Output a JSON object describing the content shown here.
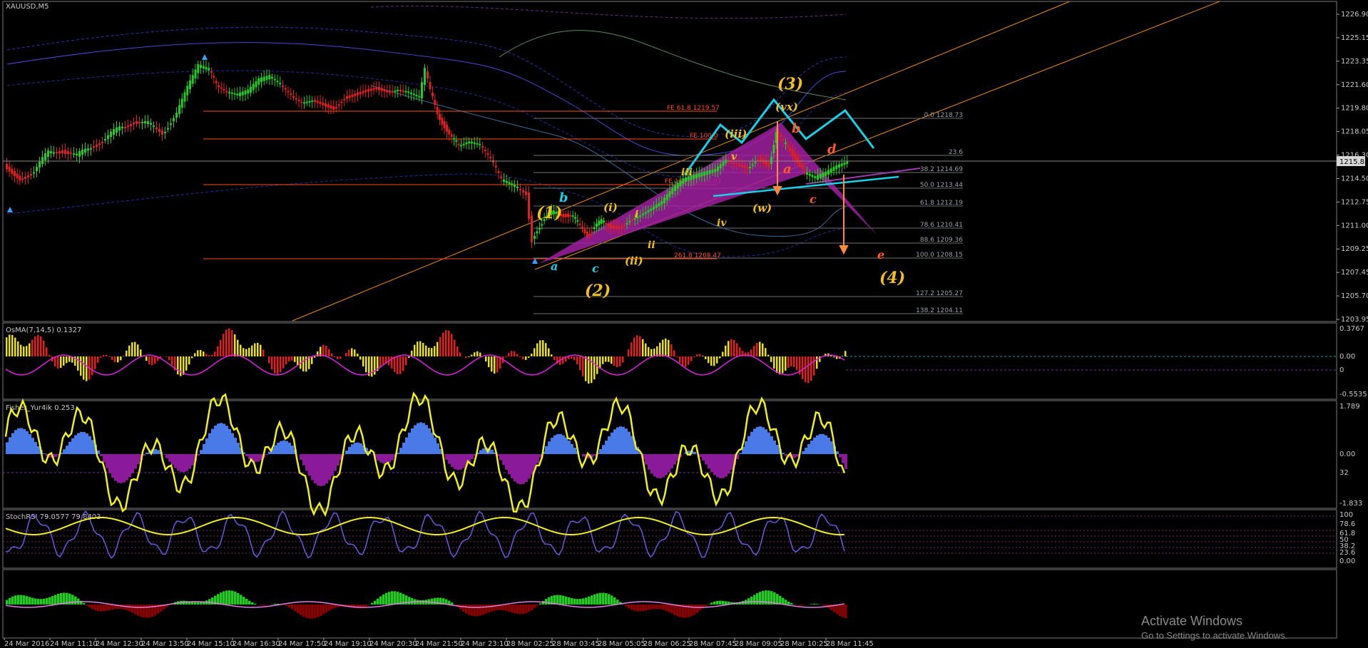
{
  "symbol": "XAUUSD,M5",
  "main_chart": {
    "type": "candlestick",
    "price_ticks": [
      "1226.90",
      "1225.15",
      "1223.35",
      "1221.60",
      "1219.80",
      "1218.05",
      "1216.30",
      "1214.50",
      "1212.75",
      "1211.00",
      "1209.25",
      "1207.45",
      "1205.70",
      "1203.95"
    ],
    "current_price": "1215.85",
    "ylim": [
      1203.95,
      1227.1
    ]
  },
  "time_ticks": [
    "24 Mar 2016",
    "24 Mar 11:10",
    "24 Mar 12:30",
    "24 Mar 13:50",
    "24 Mar 15:10",
    "24 Mar 16:30",
    "24 Mar 17:50",
    "24 Mar 19:10",
    "24 Mar 20:30",
    "24 Mar 21:50",
    "24 Mar 23:10",
    "28 Mar 02:25",
    "28 Mar 03:45",
    "28 Mar 05:05",
    "28 Mar 06:25",
    "28 Mar 07:45",
    "28 Mar 09:05",
    "28 Mar 10:25",
    "28 Mar 11:45"
  ],
  "fe_levels": [
    "FE 61.8 1219.57",
    "FE 100.0",
    "FE 161.8 1214.02",
    "261.8 1208.47"
  ],
  "fib_levels": [
    "0.0 1218.73",
    "23.6",
    "38.2 1214.69",
    "50.0 1213.44",
    "61.8 1212.19",
    "78.6 1210.41",
    "88.6 1209.36",
    "100.0 1208.15",
    "127.2 1205.27",
    "138.2 1204.11"
  ],
  "wave_labels": {
    "w1": "(1)",
    "w2": "(2)",
    "w3": "(3)",
    "w4": "(4)",
    "a_blue": "a",
    "b_blue": "b",
    "c_blue": "c",
    "i_paren": "(i)",
    "ii_paren": "(ii)",
    "iii_paren": "(iii)",
    "i_small": "i",
    "ii_small": "ii",
    "iii_small": "iii",
    "iv_small": "iv",
    "v_small": "v",
    "w_paren": "(w)",
    "vx_paren": "(vx)",
    "a_red": "a",
    "b_red": "b",
    "c_red": "c",
    "d_red": "d",
    "e_red": "e"
  },
  "osma": {
    "label": "OsMA(7,14,5) 0.1327",
    "ticks": [
      "0.3767",
      "0.00",
      "0",
      "-0.5535"
    ]
  },
  "fisher": {
    "label": "Fisher_Yur4ik 0.253",
    "ticks": [
      "1.789",
      "0.00",
      "32",
      "-1.833"
    ]
  },
  "stochrsi": {
    "label": "StochRSI 79.0577 79.8403",
    "ticks": [
      "100",
      "78.6",
      "61.8",
      "50",
      "38.2",
      "23.6",
      "0.00"
    ]
  },
  "watermark": {
    "line1": "Activate Windows",
    "line2": "Go to Settings to activate Windows."
  },
  "colors": {
    "bull": "#22cc22",
    "bear": "#e02020",
    "wave": "#f0c020",
    "cyan": "#19d0e8",
    "magenta": "#a020a0",
    "fib": "#ff4a1c",
    "trend": "#e88a10"
  }
}
